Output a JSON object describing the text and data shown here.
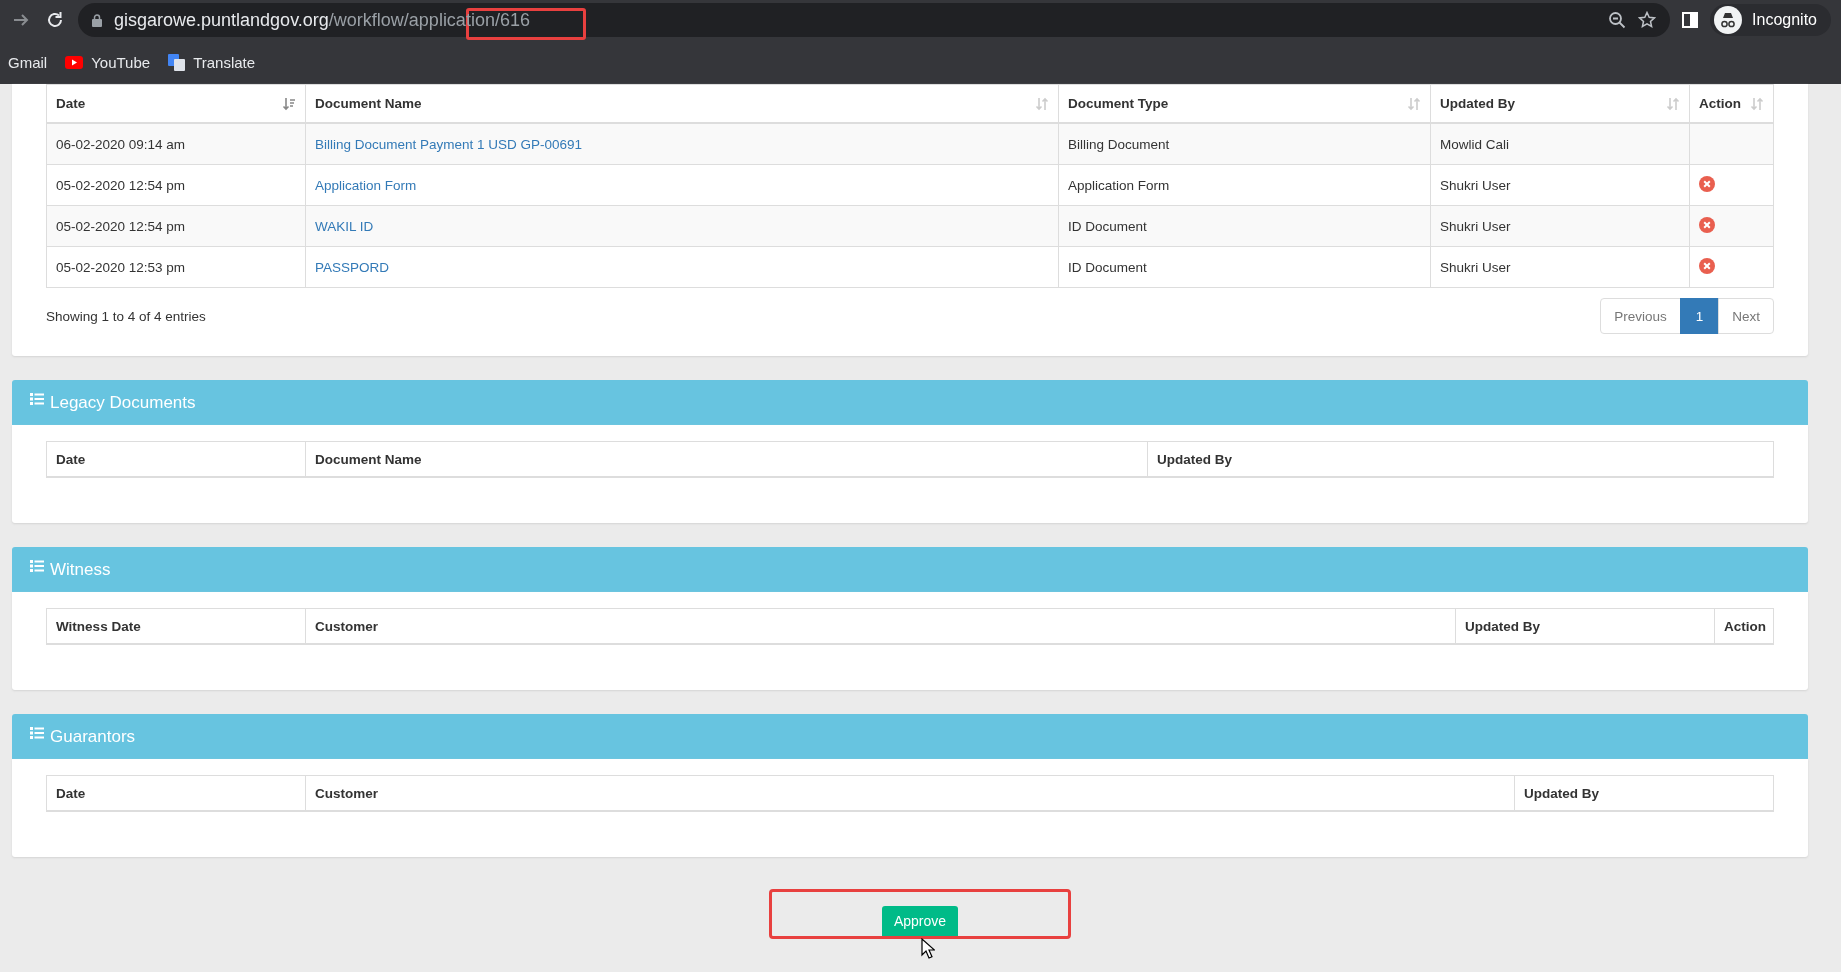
{
  "browser": {
    "url_host": "gisgarowe.puntlandgov.org",
    "url_path": "/workflow/application/616",
    "profile_label": "Incognito",
    "bookmarks": [
      {
        "label": "Gmail",
        "kind": "plain"
      },
      {
        "label": "YouTube",
        "kind": "youtube"
      },
      {
        "label": "Translate",
        "kind": "translate"
      }
    ]
  },
  "documents_table": {
    "columns": [
      {
        "label": "Date",
        "sorted": true
      },
      {
        "label": "Document Name",
        "sorted": false
      },
      {
        "label": "Document Type",
        "sorted": false
      },
      {
        "label": "Updated By",
        "sorted": false
      },
      {
        "label": "Action",
        "sorted": false
      }
    ],
    "rows": [
      {
        "date": "06-02-2020 09:14 am",
        "document_name": "Billing Document Payment 1 USD GP-00691",
        "document_type": "Billing Document",
        "updated_by": "Mowlid Cali",
        "deletable": false
      },
      {
        "date": "05-02-2020 12:54 pm",
        "document_name": "Application Form",
        "document_type": "Application Form",
        "updated_by": "Shukri User",
        "deletable": true
      },
      {
        "date": "05-02-2020 12:54 pm",
        "document_name": "WAKIL ID",
        "document_type": "ID Document",
        "updated_by": "Shukri User",
        "deletable": true
      },
      {
        "date": "05-02-2020 12:53 pm",
        "document_name": "PASSPORD",
        "document_type": "ID Document",
        "updated_by": "Shukri User",
        "deletable": true
      }
    ],
    "info": "Showing 1 to 4 of 4 entries",
    "pagination": [
      {
        "label": "Previous",
        "selected": false
      },
      {
        "label": "1",
        "selected": true
      },
      {
        "label": "Next",
        "selected": false
      }
    ]
  },
  "sections": [
    {
      "title": "Legacy Documents",
      "columns": [
        "Date",
        "Document Name",
        "Updated By"
      ]
    },
    {
      "title": "Witness",
      "columns": [
        "Witness Date",
        "Customer",
        "Updated By",
        "Action"
      ]
    },
    {
      "title": "Guarantors",
      "columns": [
        "Date",
        "Customer",
        "Updated By"
      ]
    }
  ],
  "approve_button": "Approve"
}
